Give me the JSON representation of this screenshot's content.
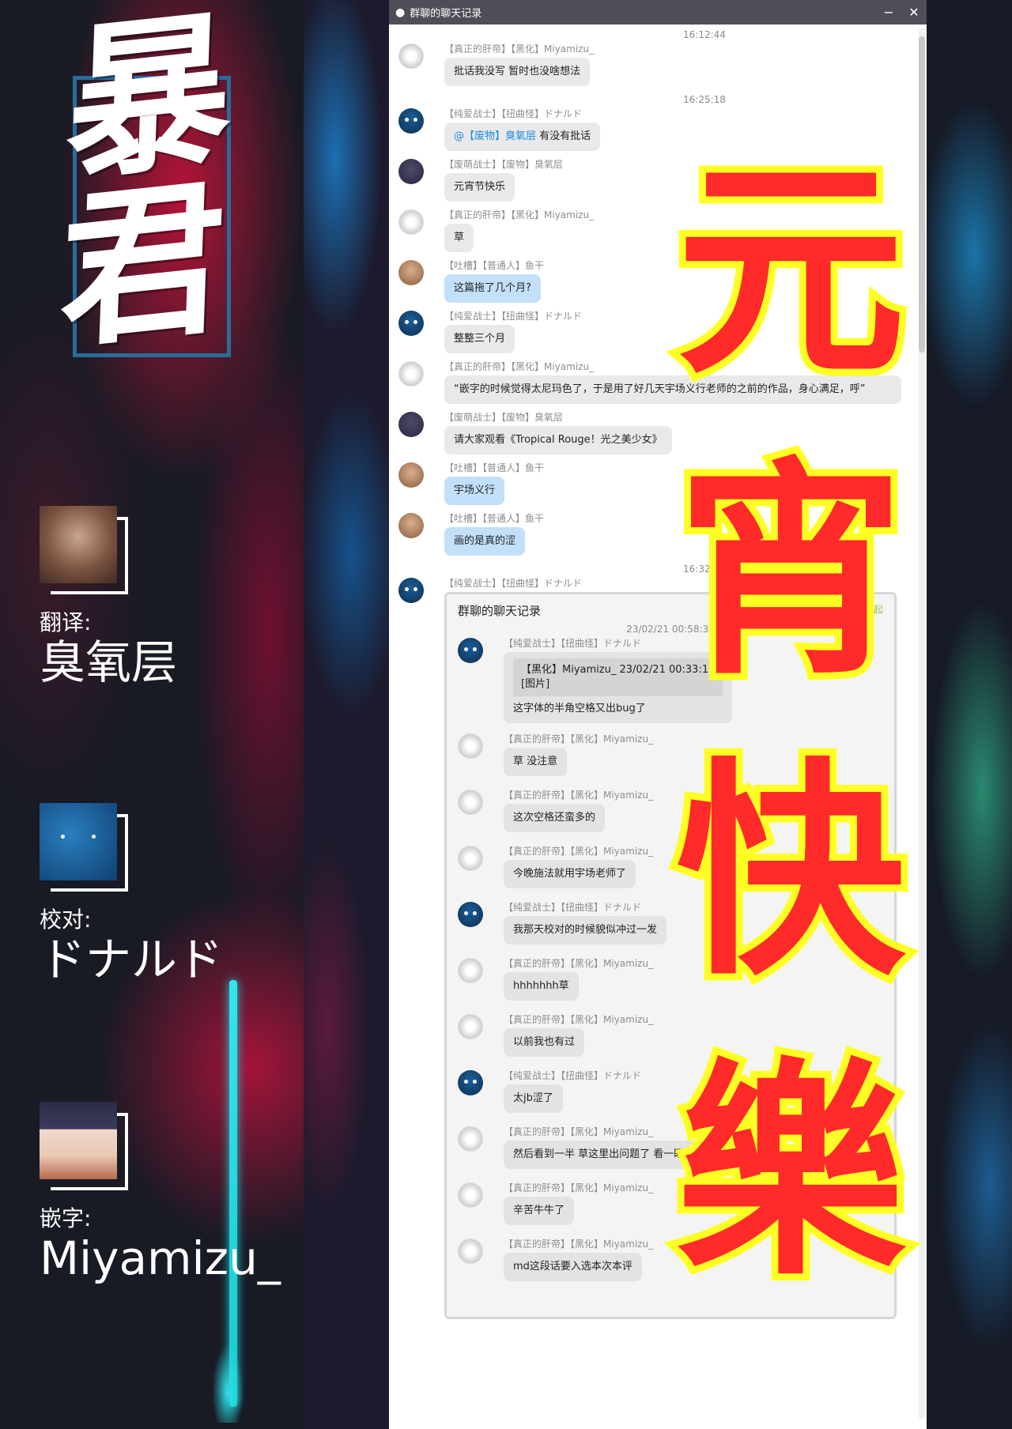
{
  "logo": {
    "text": "暴君"
  },
  "credits": [
    {
      "role": "翻译:",
      "name": "臭氧层"
    },
    {
      "role": "校对:",
      "name": "ドナルド"
    },
    {
      "role": "嵌字:",
      "name": "Miyamizu_"
    }
  ],
  "window": {
    "title": "群聊的聊天记录",
    "minimize": "−",
    "close": "✕"
  },
  "overlay": {
    "chars": [
      "元",
      "宵",
      "快",
      "樂"
    ]
  },
  "chat": {
    "timestamps": [
      "16:12:44",
      "16:25:18",
      "16:32:04"
    ],
    "messages": [
      {
        "meta": "【真正的肝帝】【黑化】Miyamizu_",
        "text": "批话我没写 暂时也没啥想法"
      },
      {
        "meta": "【纯爱战士】【扭曲怪】ドナルド",
        "mention": "@【废物】臭氧层",
        "text": " 有没有批话"
      },
      {
        "meta": "【废萌战士】【废物】臭氧层",
        "text": "元宵节快乐"
      },
      {
        "meta": "【真正的肝帝】【黑化】Miyamizu_",
        "text": "草"
      },
      {
        "meta": "【吐槽】【普通人】鱼干",
        "text": "这篇拖了几个月?"
      },
      {
        "meta": "【纯爱战士】【扭曲怪】ドナルド",
        "text": "整整三个月"
      },
      {
        "meta": "【真正的肝帝】【黑化】Miyamizu_",
        "text": "“嵌字的时候觉得太尼玛色了，于是用了好几天宇场义行老师的之前的作品，身心满足，呼”"
      },
      {
        "meta": "【废萌战士】【废物】臭氧层",
        "text": "请大家观看《Tropical Rouge！光之美少女》"
      },
      {
        "meta": "【吐槽】【普通人】鱼干",
        "text": "宇场义行"
      },
      {
        "meta": "【吐槽】【普通人】鱼干",
        "text": "画的是真的涩"
      },
      {
        "meta": "【纯爱战士】【扭曲怪】ドナルド"
      }
    ],
    "forward": {
      "title": "群聊的聊天记录",
      "collapse": "收起",
      "timestamp": "23/02/21 00:58:32",
      "quote_header": "【黑化】Miyamizu_  23/02/21 00:33:11",
      "quote_body": "[图片]",
      "messages": [
        {
          "meta": "【纯爱战士】【扭曲怪】ドナルド",
          "text": "这字体的半角空格又出bug了"
        },
        {
          "meta": "【真正的肝帝】【黑化】Miyamizu_",
          "text": "草 没注意"
        },
        {
          "meta": "【真正的肝帝】【黑化】Miyamizu_",
          "text": "这次空格还蛮多的"
        },
        {
          "meta": "【真正的肝帝】【黑化】Miyamizu_",
          "text": "今晚施法就用宇场老师了"
        },
        {
          "meta": "【纯爱战士】【扭曲怪】ドナルド",
          "text": "我那天校对的时候貌似冲过一发"
        },
        {
          "meta": "【真正的肝帝】【黑化】Miyamizu_",
          "text": "hhhhhhh草"
        },
        {
          "meta": "【真正的肝帝】【黑化】Miyamizu_",
          "text": "以前我也有过"
        },
        {
          "meta": "【纯爱战士】【扭曲怪】ドナルド",
          "text": "太jb涩了"
        },
        {
          "meta": "【真正的肝帝】【黑化】Miyamizu_",
          "text": "然后看到一半 草这里出问题了 看一眼页码 继续"
        },
        {
          "meta": "【真正的肝帝】【黑化】Miyamizu_",
          "text": "辛苦牛牛了"
        },
        {
          "meta": "【真正的肝帝】【黑化】Miyamizu_",
          "text": "md这段话要入选本次本评"
        }
      ]
    }
  }
}
